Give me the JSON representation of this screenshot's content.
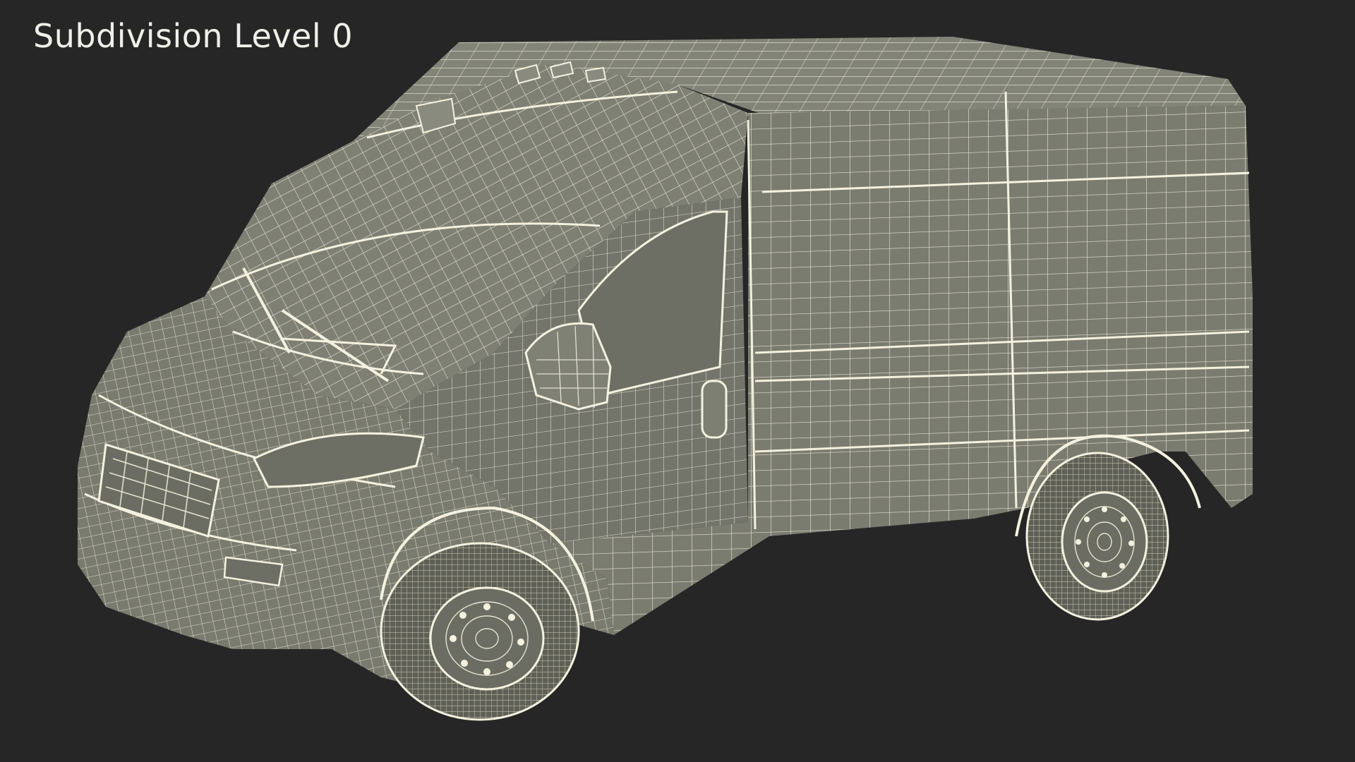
{
  "viewport": {
    "label": "Subdivision Level 0",
    "subject_icon": "van-wireframe-icon"
  },
  "colors": {
    "background": "#262626",
    "label_text": "#f0f0ea",
    "body_fill": "#7d7e71",
    "body_fill_dark": "#6d6e62",
    "wire": "#f4f1df",
    "tire_fill": "#5f6055"
  }
}
